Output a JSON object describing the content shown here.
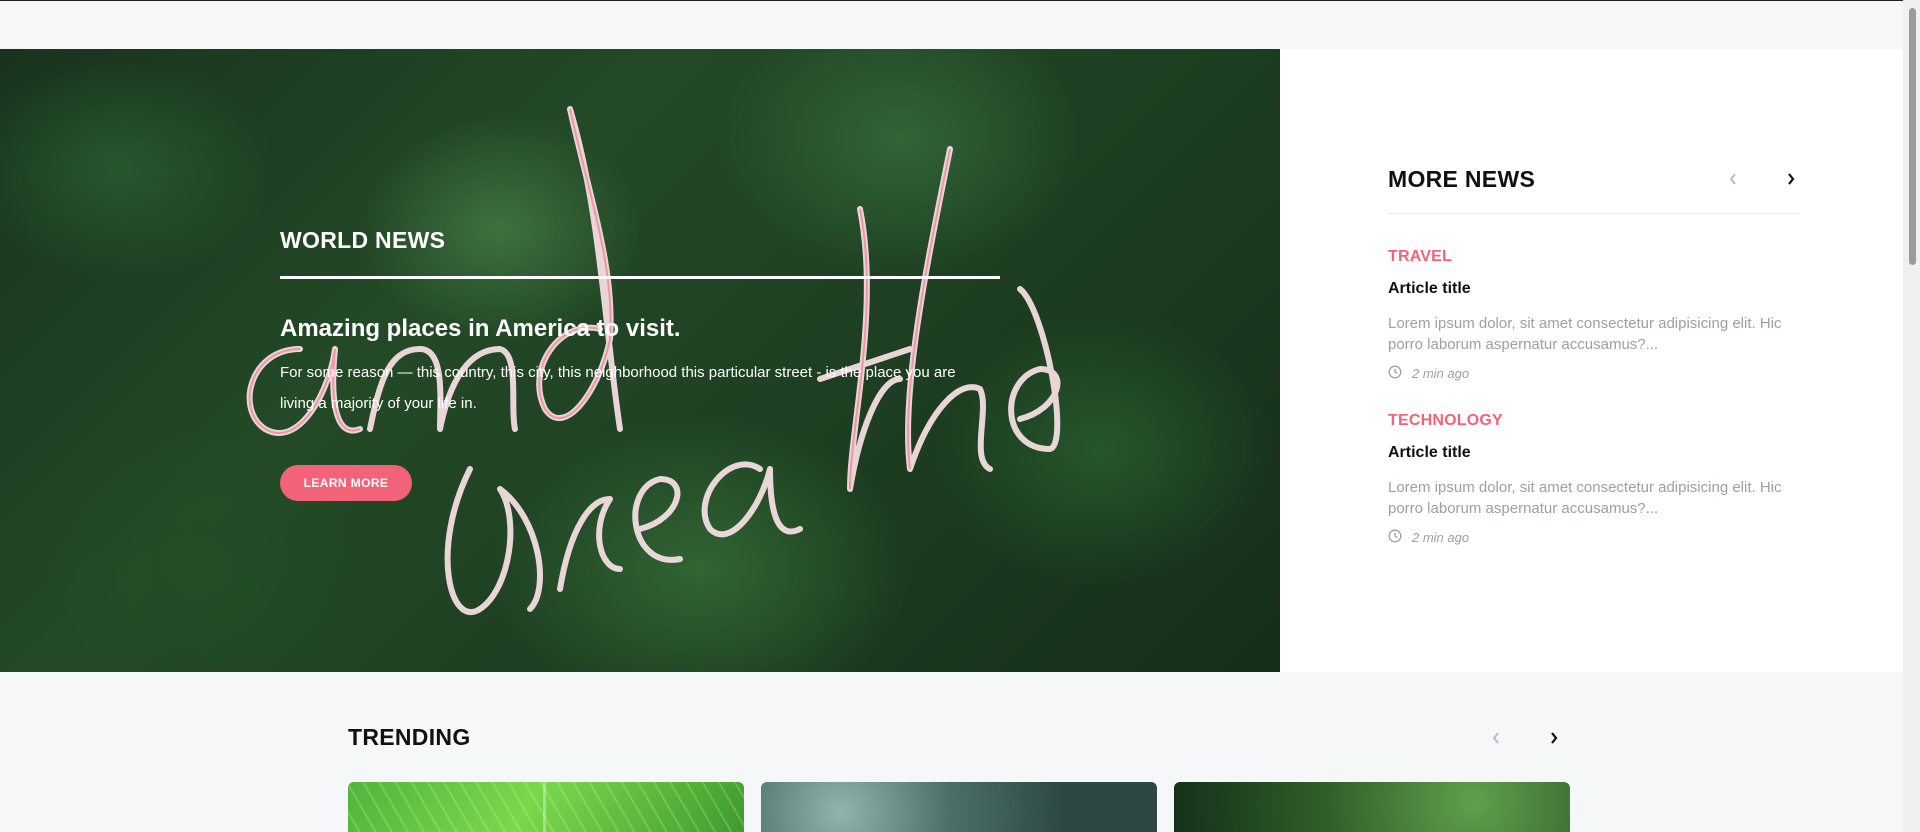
{
  "hero": {
    "category": "WORLD NEWS",
    "title": "Amazing places in America to visit.",
    "text": "For some reason — this country, this city, this neighborhood this particular street - is the place you are living a majority of your life in.",
    "button_label": "LEARN MORE",
    "accent_color": "#f2637a"
  },
  "more_news": {
    "title": "MORE NEWS",
    "articles": [
      {
        "category": "TRAVEL",
        "title": "Article title",
        "excerpt": "Lorem ipsum dolor, sit amet consectetur adipisicing elit. Hic porro laborum aspernatur accusamus?...",
        "time": "2 min ago"
      },
      {
        "category": "TECHNOLOGY",
        "title": "Article title",
        "excerpt": "Lorem ipsum dolor, sit amet consectetur adipisicing elit. Hic porro laborum aspernatur accusamus?...",
        "time": "2 min ago"
      }
    ]
  },
  "trending": {
    "title": "TRENDING"
  },
  "icons": {
    "prev": "chevron-left-icon",
    "next": "chevron-right-icon",
    "clock": "clock-icon"
  }
}
